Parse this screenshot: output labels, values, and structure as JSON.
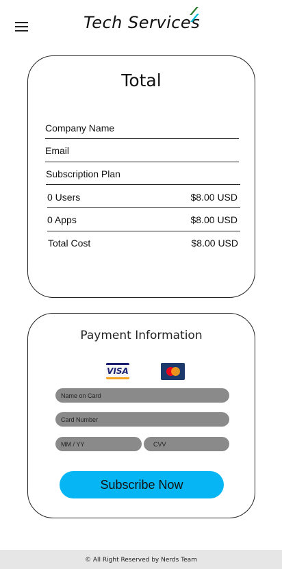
{
  "header": {
    "brand": "Tech Services",
    "menu_icon": "hamburger-menu-icon",
    "logo_icon": "leaf-slash-icon",
    "logo_colors": [
      "#2e7d32",
      "#00bcd4"
    ]
  },
  "total_card": {
    "title": "Total",
    "company_name_label": "Company Name",
    "email_label": "Email",
    "subscription_plan_label": "Subscription Plan",
    "rows": [
      {
        "label": "0 Users",
        "value": "$8.00 USD"
      },
      {
        "label": "0 Apps",
        "value": "$8.00 USD"
      },
      {
        "label": "Total Cost",
        "value": "$8.00 USD"
      }
    ]
  },
  "payment_card": {
    "title": "Payment Information",
    "visa_text": "VISA",
    "visa_icon": "visa-card-icon",
    "mastercard_icon": "mastercard-card-icon",
    "name_on_card_placeholder": "Name on Card",
    "card_number_placeholder": "Card Number",
    "expiry_placeholder": "MM / YY",
    "cvv_placeholder": "CVV",
    "subscribe_label": "Subscribe Now",
    "accent_color": "#06b6f4"
  },
  "footer": {
    "text": "© All Right Reserved by Nerds Team"
  }
}
